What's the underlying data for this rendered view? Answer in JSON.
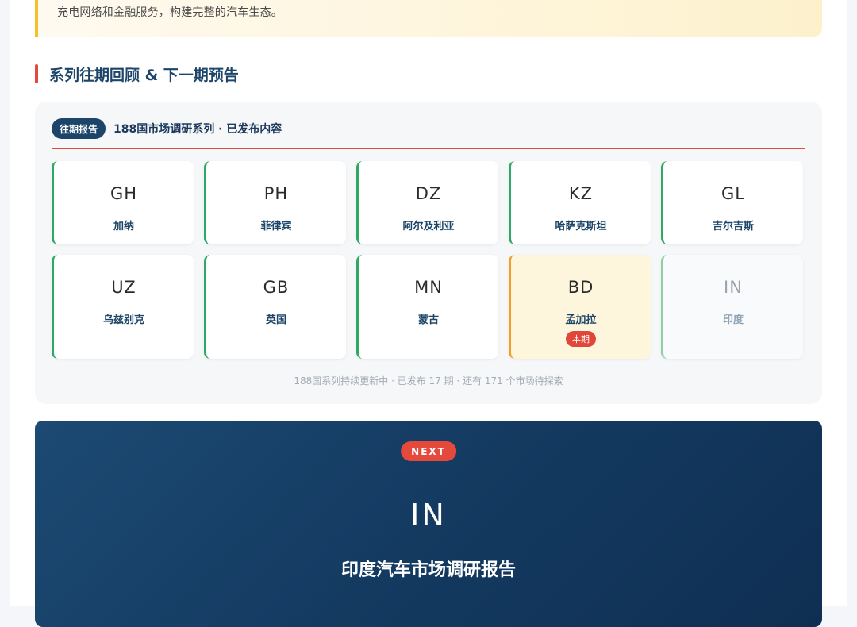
{
  "intro": {
    "text": "充电网络和金融服务，构建完整的汽车生态。"
  },
  "section": {
    "heading": "系列往期回顾 & 下一期预告"
  },
  "archive": {
    "badge": "往期报告",
    "title": "188国市场调研系列 · 已发布内容",
    "countries": [
      {
        "code": "GH",
        "name": "加纳",
        "status": "published"
      },
      {
        "code": "PH",
        "name": "菲律宾",
        "status": "published"
      },
      {
        "code": "DZ",
        "name": "阿尔及利亚",
        "status": "published"
      },
      {
        "code": "KZ",
        "name": "哈萨克斯坦",
        "status": "published"
      },
      {
        "code": "GL",
        "name": "吉尔吉斯",
        "status": "published"
      },
      {
        "code": "UZ",
        "name": "乌兹别克",
        "status": "published"
      },
      {
        "code": "GB",
        "name": "英国",
        "status": "published"
      },
      {
        "code": "MN",
        "name": "蒙古",
        "status": "published"
      },
      {
        "code": "BD",
        "name": "孟加拉",
        "status": "current",
        "tag": "本期"
      },
      {
        "code": "IN",
        "name": "印度",
        "status": "upcoming"
      }
    ],
    "footer": "188国系列持续更新中 · 已发布 17 期 · 还有 171 个市场待探索"
  },
  "next": {
    "badge": "NEXT",
    "code": "IN",
    "title": "印度汽车市场调研报告"
  },
  "colors": {
    "accent_red": "#e24a3b",
    "navy": "#1d4569",
    "published_green": "#2fa864",
    "current_orange": "#f0a02a",
    "callout_yellow": "#f2c12e"
  }
}
